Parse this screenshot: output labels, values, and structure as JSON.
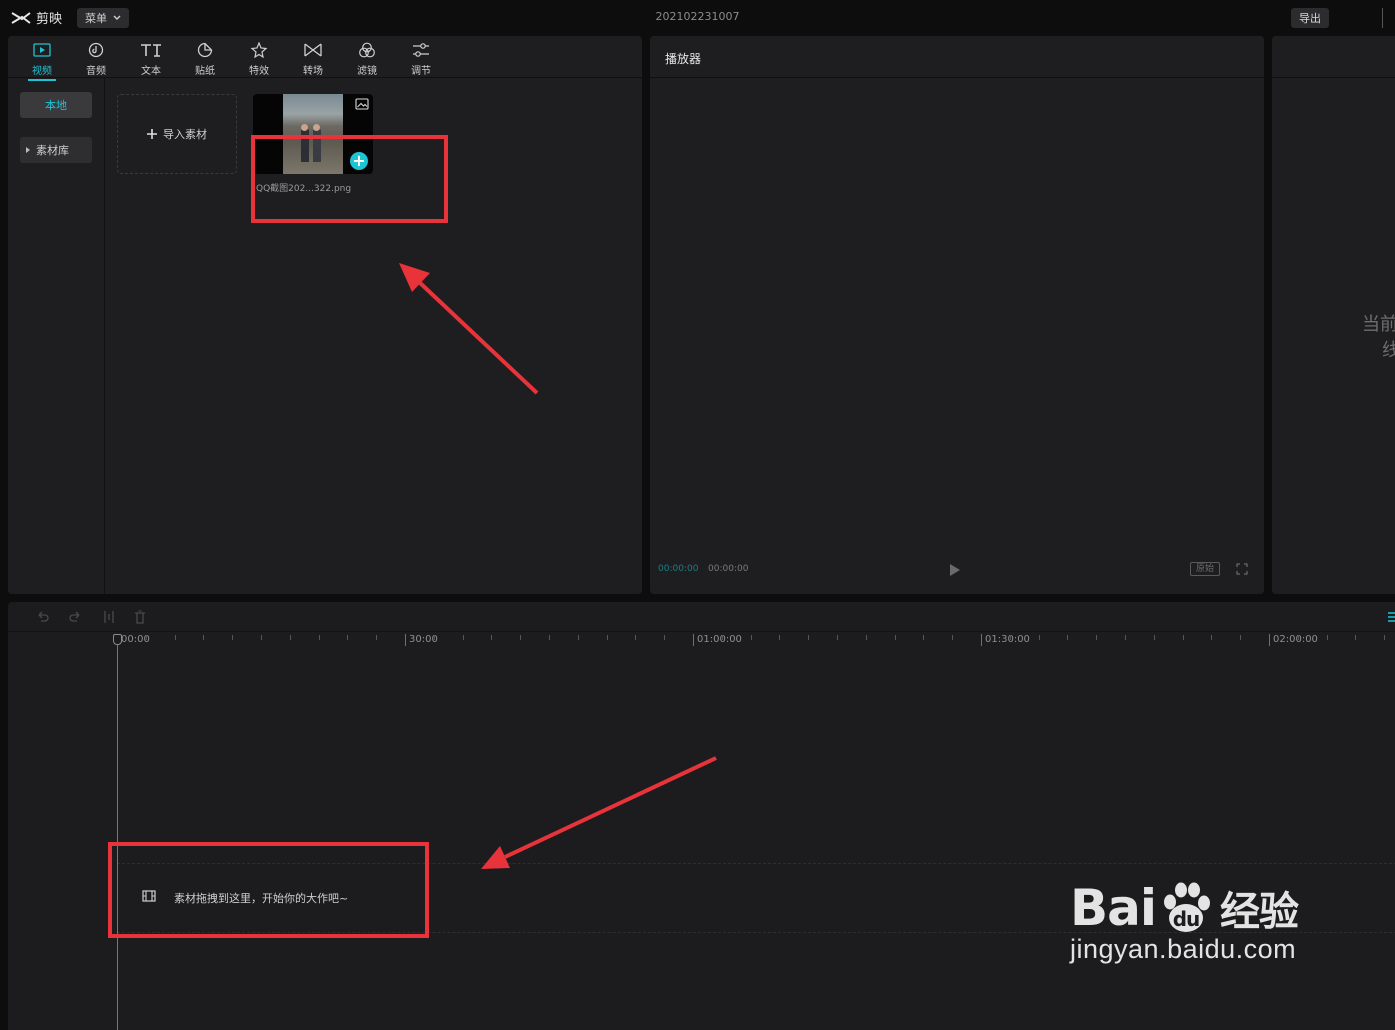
{
  "titlebar": {
    "app_name": "剪映",
    "menu_label": "菜单",
    "project_title": "202102231007",
    "export_label": "导出"
  },
  "media": {
    "tabs": [
      {
        "label": "视频",
        "icon": "video-icon",
        "active": true
      },
      {
        "label": "音频",
        "icon": "audio-icon",
        "active": false
      },
      {
        "label": "文本",
        "icon": "text-icon",
        "active": false
      },
      {
        "label": "贴纸",
        "icon": "sticker-icon",
        "active": false
      },
      {
        "label": "特效",
        "icon": "effects-icon",
        "active": false
      },
      {
        "label": "转场",
        "icon": "transition-icon",
        "active": false
      },
      {
        "label": "滤镜",
        "icon": "filter-icon",
        "active": false
      },
      {
        "label": "调节",
        "icon": "adjust-icon",
        "active": false
      }
    ],
    "sidebar": {
      "local": "本地",
      "library": "素材库"
    },
    "import_label": "导入素材",
    "file_name": "QQ截图202...322.png"
  },
  "player": {
    "title": "播放器",
    "current_time": "00:00:00",
    "total_time": "00:00:00",
    "original_label": "原始"
  },
  "right_panel": {
    "message_line1": "当前",
    "message_line2": "线"
  },
  "timeline": {
    "ruler_labels": [
      "00:00",
      "30:00",
      "01:00:00",
      "01:30:00",
      "02:00:00"
    ],
    "drop_hint": "素材拖拽到这里，开始你的大作吧~"
  },
  "watermark": {
    "brand": "Bai",
    "brand2": "du",
    "brand_cn": "经验",
    "url": "jingyan.baidu.com"
  },
  "colors": {
    "accent": "#1ec3d4",
    "panel": "#1e1e20",
    "annotation_red": "#e8333a"
  }
}
